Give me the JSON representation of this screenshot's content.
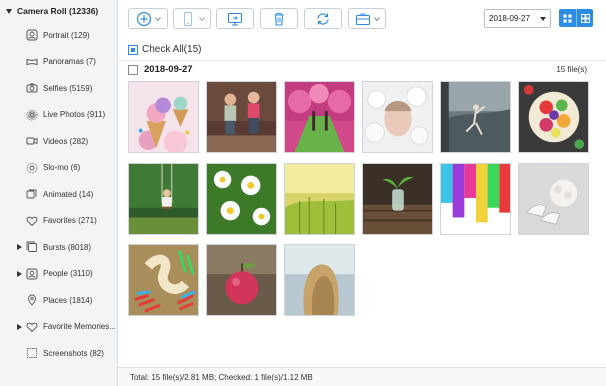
{
  "sidebar": {
    "root_label": "Camera Roll (12336)",
    "items": [
      {
        "label": "Portrait (129)",
        "icon": "portrait-icon",
        "expandable": false
      },
      {
        "label": "Panoramas (7)",
        "icon": "panorama-icon",
        "expandable": false
      },
      {
        "label": "Selfies (5159)",
        "icon": "selfie-icon",
        "expandable": false
      },
      {
        "label": "Live Photos (911)",
        "icon": "live-photo-icon",
        "expandable": false
      },
      {
        "label": "Videos (282)",
        "icon": "video-icon",
        "expandable": false
      },
      {
        "label": "Slo-mo (6)",
        "icon": "slo-mo-icon",
        "expandable": false
      },
      {
        "label": "Animated (14)",
        "icon": "animated-icon",
        "expandable": false
      },
      {
        "label": "Favorites (271)",
        "icon": "heart-icon",
        "expandable": false
      },
      {
        "label": "Bursts (8018)",
        "icon": "burst-icon",
        "expandable": true
      },
      {
        "label": "People (3110)",
        "icon": "people-icon",
        "expandable": true
      },
      {
        "label": "Places (1814)",
        "icon": "location-pin-icon",
        "expandable": false
      },
      {
        "label": "Favorite Memories...",
        "icon": "heart-icon",
        "expandable": true
      },
      {
        "label": "Screenshots (82)",
        "icon": "screenshot-icon",
        "expandable": false
      }
    ]
  },
  "toolbar": {
    "buttons": [
      "add-icon",
      "export-to-device-icon",
      "export-to-pc-icon",
      "delete-icon",
      "refresh-icon",
      "toolbox-icon"
    ],
    "date_value": "2018-09-27"
  },
  "content": {
    "check_all_label": "Check All(15)",
    "group": {
      "date": "2018-09-27",
      "count": "15 file(s)"
    },
    "photos": [
      "ice-cream",
      "two-children",
      "blossom-trees",
      "white-flowers-portrait",
      "dancer-in-mist",
      "fruit-bowl",
      "girl-on-swing",
      "daisies",
      "wheat-field",
      "sprout-in-bottle",
      "paint-drips",
      "wedding-bouquet",
      "colored-pencils",
      "red-apple",
      "blonde-hair"
    ]
  },
  "status": {
    "text": "Total: 15 file(s)/2.81 MB; Checked: 1 file(s)/1.12 MB"
  },
  "colors": {
    "accent": "#2d8de3",
    "sidebar_bg": "#f3f4f6"
  }
}
